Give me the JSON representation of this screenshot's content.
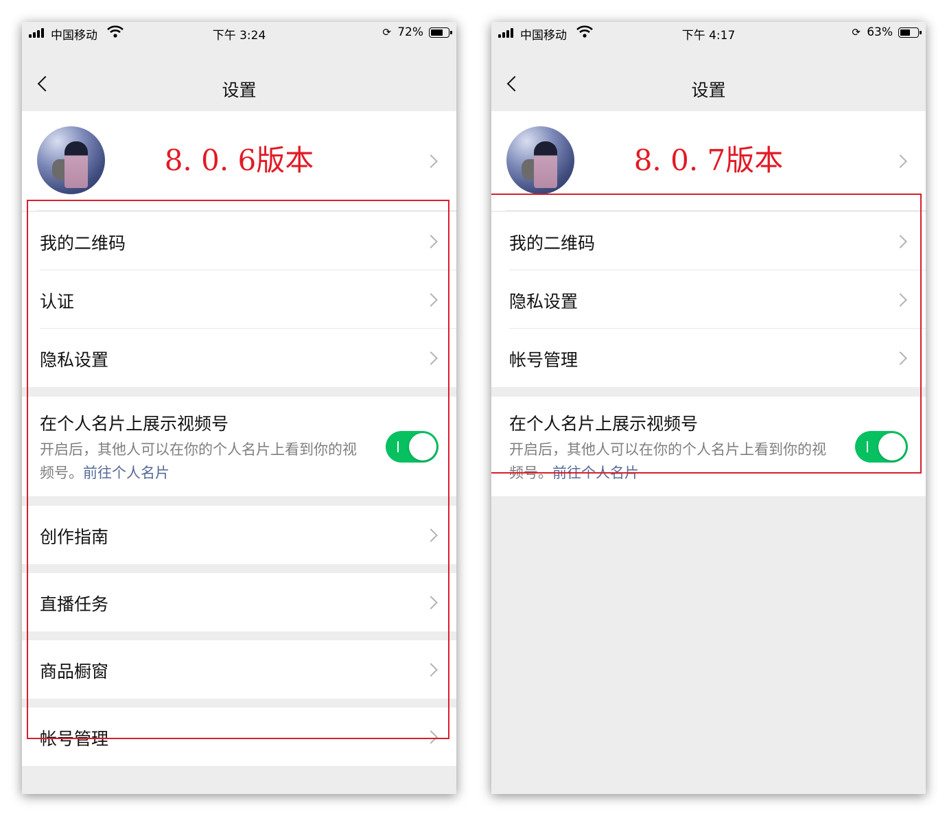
{
  "left": {
    "status": {
      "carrier": "中国移动",
      "time": "下午 3:24",
      "battery": "72%",
      "battery_level": 0.72
    },
    "nav_title": "设置",
    "version_label": "8. 0. 6版本",
    "items": [
      {
        "label": "我的二维码"
      },
      {
        "label": "认证"
      },
      {
        "label": "隐私设置"
      }
    ],
    "toggle": {
      "title": "在个人名片上展示视频号",
      "desc": "开启后，其他人可以在你的个人名片上看到你的视频号。",
      "link": "前往个人名片",
      "enabled": true
    },
    "extra_items": [
      {
        "label": "创作指南"
      },
      {
        "label": "直播任务"
      },
      {
        "label": "商品橱窗"
      },
      {
        "label": "帐号管理"
      }
    ]
  },
  "right": {
    "status": {
      "carrier": "中国移动",
      "time": "下午 4:17",
      "battery": "63%",
      "battery_level": 0.63
    },
    "nav_title": "设置",
    "version_label": "8. 0. 7版本",
    "items": [
      {
        "label": "我的二维码"
      },
      {
        "label": "隐私设置"
      },
      {
        "label": "帐号管理"
      }
    ],
    "toggle": {
      "title": "在个人名片上展示视频号",
      "desc": "开启后，其他人可以在你的个人名片上看到你的视频号。",
      "link": "前往个人名片",
      "enabled": true
    }
  },
  "colors": {
    "annotation": "#d81e2c",
    "toggle_on": "#07c160",
    "link": "#576b95",
    "version_text": "#e21a24"
  }
}
